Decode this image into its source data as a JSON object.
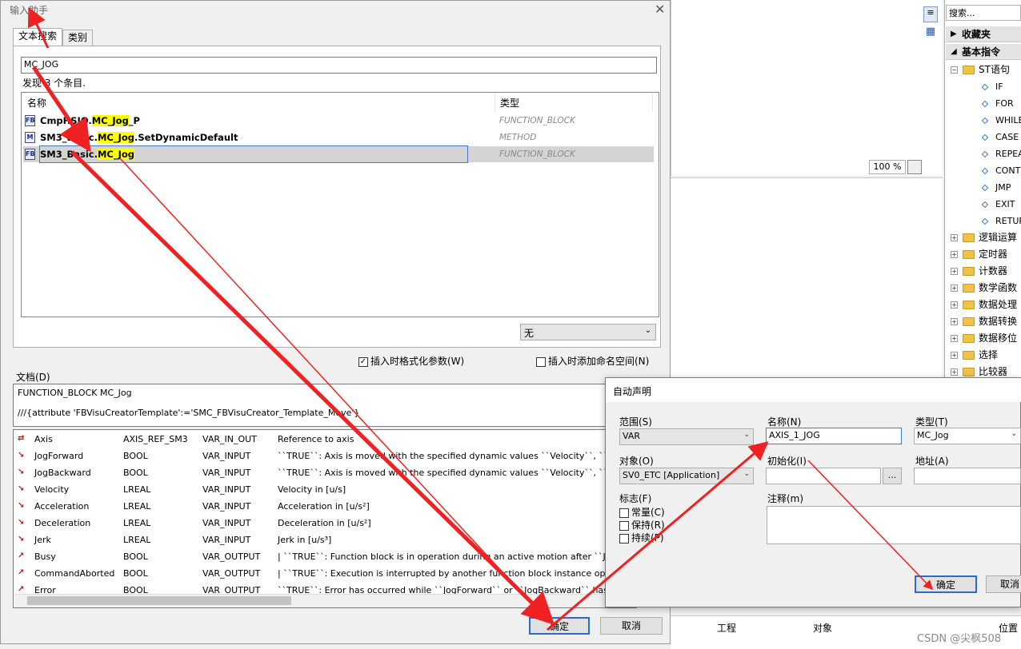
{
  "toolbox": {
    "search_placeholder": "搜索...",
    "favorites": "收藏夹",
    "basic": "基本指令",
    "st_folder": "ST语句",
    "st_items": [
      "IF",
      "FOR",
      "WHILE",
      "CASE",
      "REPEAT",
      "CONTINUE",
      "JMP",
      "EXIT",
      "RETURN"
    ],
    "folders": [
      "逻辑运算",
      "定时器",
      "计数器",
      "数学函数",
      "数据处理",
      "数据转换",
      "数据移位",
      "选择",
      "比较器"
    ]
  },
  "ide": {
    "zoom": "100 %",
    "bottom_cols": [
      "工程",
      "对象",
      "位置"
    ]
  },
  "main_dialog": {
    "title": "输入助手",
    "tab_text_search": "文本搜索",
    "tab_category": "类别",
    "search_value": "MC_JOG",
    "found": "发现 3 个条目.",
    "col_name": "名称",
    "col_type": "类型",
    "results": [
      {
        "prefix": "CmpHSIO.",
        "match": "MC_Jog",
        "suffix": "_P",
        "type": "FUNCTION_BLOCK",
        "icon": "FB"
      },
      {
        "prefix": "SM3_Basic.",
        "match": "MC_Jog",
        "suffix": ".SetDynamicDefault",
        "type": "METHOD",
        "icon": "M"
      },
      {
        "prefix": "SM3_Basic.",
        "match": "MC_Jog",
        "suffix": "",
        "type": "FUNCTION_BLOCK",
        "icon": "FB"
      }
    ],
    "namespace": "无",
    "chk_format": "插入时格式化参数(W)",
    "chk_namespace": "插入时添加命名空间(N)",
    "doc_label": "文档(D)",
    "doc_line1": "FUNCTION_BLOCK MC_Jog",
    "doc_line2": "///{attribute 'FBVisuCreatorTemplate':='SMC_FBVisuCreator_Template_Move'}",
    "vars": [
      {
        "name": "Axis",
        "type": "AXIS_REF_SM3",
        "scope": "VAR_IN_OUT",
        "desc": "Reference to axis"
      },
      {
        "name": "JogForward",
        "type": "BOOL",
        "scope": "VAR_INPUT",
        "desc": "``TRUE``: Axis is moved with the specified dynamic values ``Velocity``, ``Acceleration``"
      },
      {
        "name": "JogBackward",
        "type": "BOOL",
        "scope": "VAR_INPUT",
        "desc": "``TRUE``: Axis is moved with the specified dynamic values ``Velocity``, ``Acceleration``"
      },
      {
        "name": "Velocity",
        "type": "LREAL",
        "scope": "VAR_INPUT",
        "desc": "Velocity in [u/s]"
      },
      {
        "name": "Acceleration",
        "type": "LREAL",
        "scope": "VAR_INPUT",
        "desc": "Acceleration in [u/s²]"
      },
      {
        "name": "Deceleration",
        "type": "LREAL",
        "scope": "VAR_INPUT",
        "desc": "Deceleration in [u/s²]"
      },
      {
        "name": "Jerk",
        "type": "LREAL",
        "scope": "VAR_INPUT",
        "desc": "Jerk in [u/s³]"
      },
      {
        "name": "Busy",
        "type": "BOOL",
        "scope": "VAR_OUTPUT",
        "desc": "| ``TRUE``: Function block is in operation during an active motion after ``JogForward``"
      },
      {
        "name": "CommandAborted",
        "type": "BOOL",
        "scope": "VAR_OUTPUT",
        "desc": "| ``TRUE``: Execution is interrupted by another function block instance operating on"
      },
      {
        "name": "Error",
        "type": "BOOL",
        "scope": "VAR_OUTPUT",
        "desc": "``TRUE``: Error has occurred while ``JogForward`` or ``JogBackward`` has been"
      }
    ],
    "ok": "确定",
    "cancel": "取消"
  },
  "auto_dialog": {
    "title": "自动声明",
    "scope_label": "范围(S)",
    "scope_value": "VAR",
    "name_label": "名称(N)",
    "name_value": "AXIS_1_JOG",
    "type_label": "类型(T)",
    "type_value": "MC_Jog",
    "object_label": "对象(O)",
    "object_value": "SV0_ETC [Application]",
    "init_label": "初始化(I)",
    "address_label": "地址(A)",
    "flags_label": "标志(F)",
    "flag_constant": "常量(C)",
    "flag_retain": "保持(R)",
    "flag_persistent": "持续(P)",
    "comment_label": "注释(m)",
    "ok": "确定",
    "cancel": "取消"
  },
  "watermark": "CSDN @尖枫508"
}
